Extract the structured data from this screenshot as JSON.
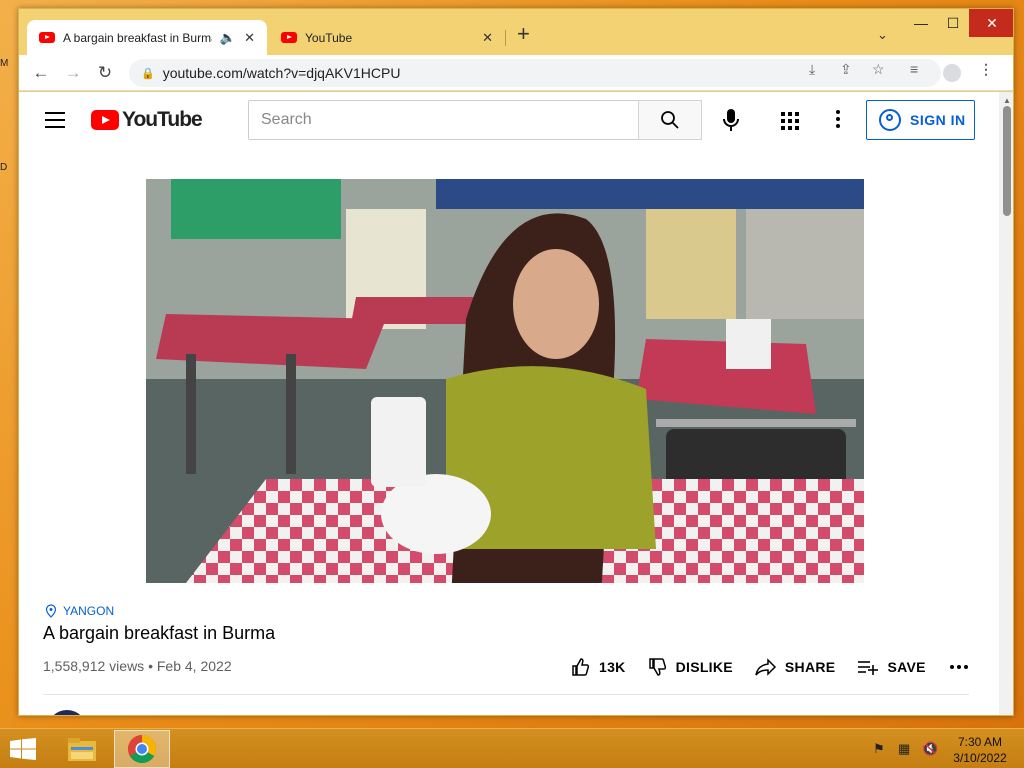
{
  "desktop": {
    "edge_letters": [
      "M",
      "D"
    ]
  },
  "browser": {
    "tabs": [
      {
        "title": "A bargain breakfast in Burma",
        "active": true,
        "audio_icon": "speaker-icon"
      },
      {
        "title": "YouTube",
        "active": false
      }
    ],
    "url": "youtube.com/watch?v=djqAKV1HCPU"
  },
  "youtube": {
    "logo_text": "YouTube",
    "search_placeholder": "Search",
    "sign_in_label": "SIGN IN"
  },
  "video": {
    "location": "YANGON",
    "title": "A bargain breakfast in Burma",
    "views": "1,558,912 views",
    "separator": "•",
    "date": "Feb 4, 2022",
    "actions": {
      "like_count": "13K",
      "dislike_label": "DISLIKE",
      "share_label": "SHARE",
      "save_label": "SAVE"
    }
  },
  "taskbar": {
    "time": "7:30 AM",
    "date": "3/10/2022"
  },
  "colors": {
    "youtube_red": "#ff0000",
    "link_blue": "#065fd4",
    "desktop_orange": "#e98d18",
    "window_frame": "#f2cf6b"
  }
}
